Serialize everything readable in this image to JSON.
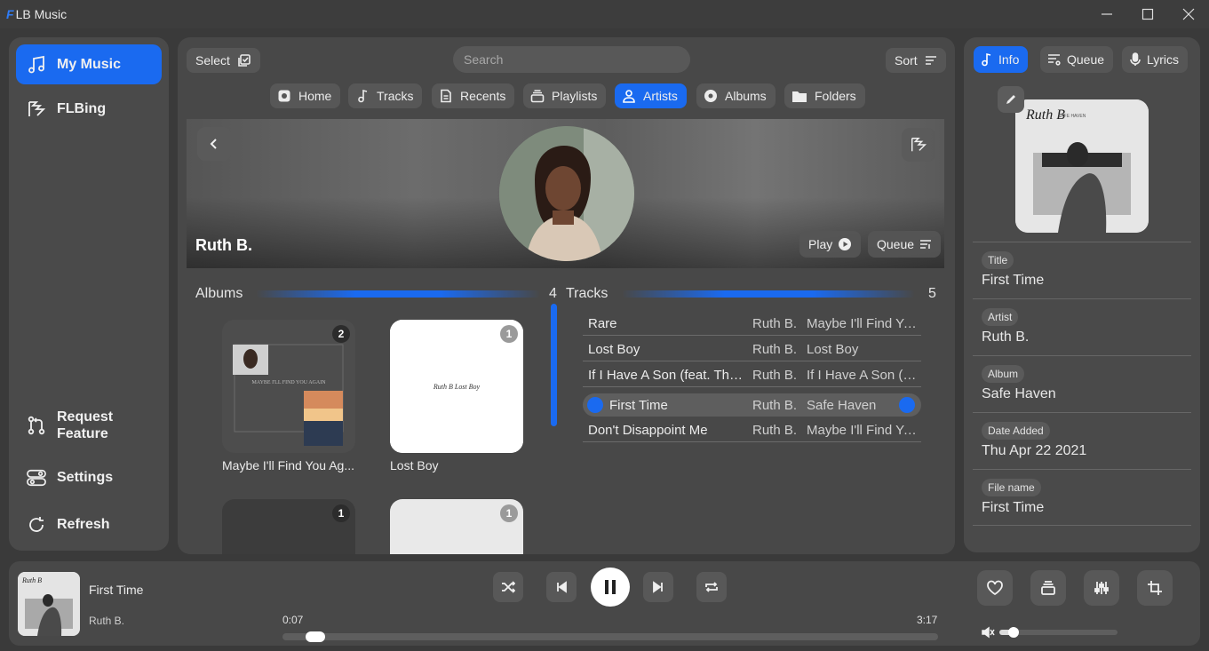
{
  "app": {
    "logo": "F",
    "title": "LB Music"
  },
  "sidebar": {
    "items": [
      {
        "label": "My Music",
        "icon": "music-note-icon",
        "active": true
      },
      {
        "label": "FLBing",
        "icon": "flbing-logo-icon"
      }
    ],
    "bottom_items": [
      {
        "label": "Request Feature",
        "line1": "Request",
        "line2": "Feature",
        "icon": "pull-request-icon"
      },
      {
        "label": "Settings",
        "icon": "toggle-icon"
      },
      {
        "label": "Refresh",
        "icon": "refresh-icon"
      }
    ]
  },
  "toolbar": {
    "select_label": "Select",
    "sort_label": "Sort"
  },
  "search": {
    "placeholder": "Search"
  },
  "tabs": [
    {
      "label": "Home",
      "icon": "home-icon"
    },
    {
      "label": "Tracks",
      "icon": "music-note-icon"
    },
    {
      "label": "Recents",
      "icon": "document-icon"
    },
    {
      "label": "Playlists",
      "icon": "stack-icon"
    },
    {
      "label": "Artists",
      "icon": "person-icon",
      "active": true
    },
    {
      "label": "Albums",
      "icon": "disc-icon"
    },
    {
      "label": "Folders",
      "icon": "folder-icon"
    }
  ],
  "artist": {
    "name": "Ruth B.",
    "play_label": "Play",
    "queue_label": "Queue",
    "albums_label": "Albums",
    "albums_count": "4",
    "tracks_label": "Tracks",
    "tracks_count": "5"
  },
  "albums": [
    {
      "name": "Maybe I'll Find You Ag...",
      "count": "2",
      "cover_text": "MAYBE I'LL FIND YOU AGAIN"
    },
    {
      "name": "Lost Boy",
      "count": "1",
      "cover_text": "Ruth B Lost Boy"
    },
    {
      "name": "",
      "count": "1"
    },
    {
      "name": "",
      "count": "1"
    }
  ],
  "tracks": [
    {
      "title": "Rare",
      "artist": "Ruth B.",
      "album": "Maybe I'll Find Yo..."
    },
    {
      "title": "Lost Boy",
      "artist": "Ruth B.",
      "album": "Lost Boy"
    },
    {
      "title": "If I Have A Son (feat. The ...",
      "artist": "Ruth B.",
      "album": "If I Have A Son (f..."
    },
    {
      "title": "First Time",
      "artist": "Ruth B.",
      "album": "Safe Haven",
      "current": true
    },
    {
      "title": "Don't Disappoint Me",
      "artist": "Ruth B.",
      "album": "Maybe I'll Find Yo..."
    }
  ],
  "info_panel": {
    "tabs": [
      {
        "label": "Info",
        "active": true
      },
      {
        "label": "Queue"
      },
      {
        "label": "Lyrics"
      }
    ],
    "cover_text": "SAFE HAVEN",
    "fields": [
      {
        "key": "Title",
        "value": "First Time"
      },
      {
        "key": "Artist",
        "value": "Ruth B."
      },
      {
        "key": "Album",
        "value": "Safe Haven"
      },
      {
        "key": "Date Added",
        "value": "Thu Apr 22 2021"
      },
      {
        "key": "File name",
        "value": "First Time"
      }
    ]
  },
  "player": {
    "title": "First Time",
    "artist": "Ruth B.",
    "elapsed": "0:07",
    "duration": "3:17",
    "progress": 0.036,
    "volume": 0.08
  },
  "colors": {
    "accent": "#1a6af0",
    "panel": "#484848",
    "background": "#3a3a3a"
  }
}
